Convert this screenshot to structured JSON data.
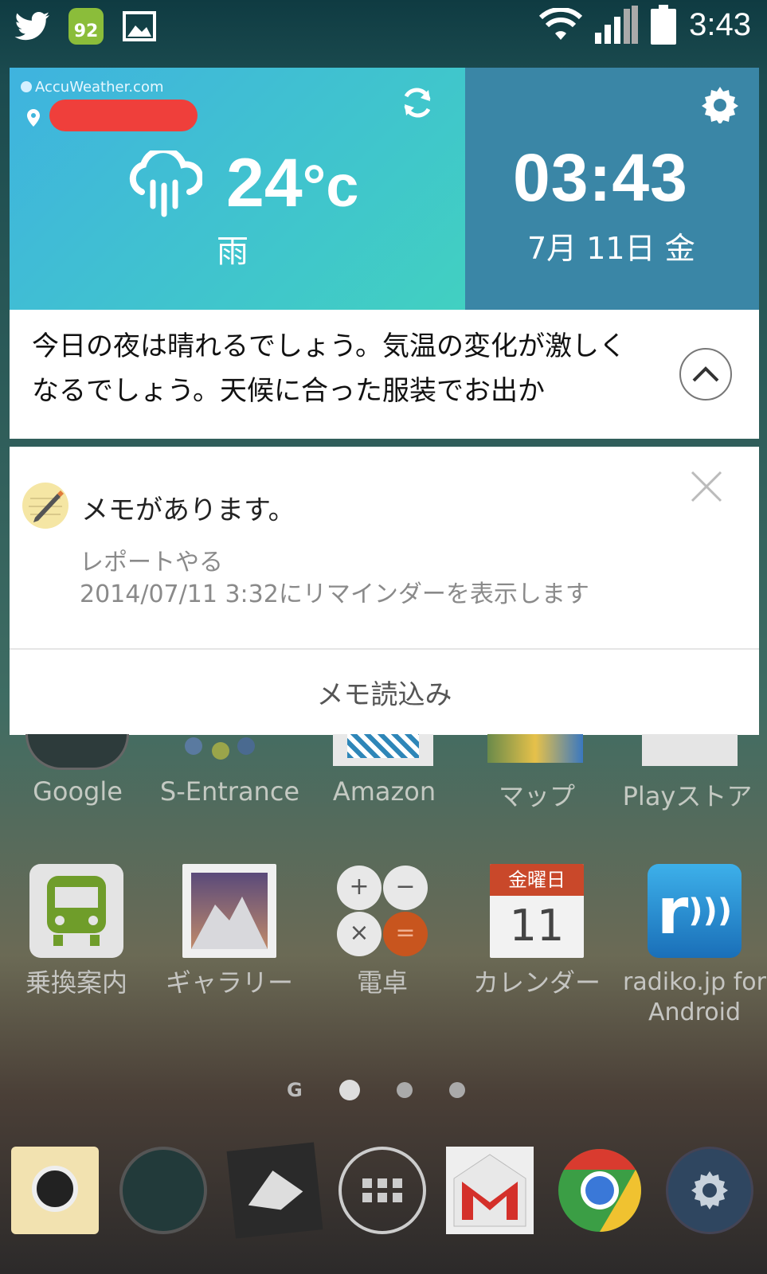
{
  "status_bar": {
    "time": "3:43",
    "notification_icons": [
      "twitter-icon",
      "android-badge-icon",
      "image-icon"
    ],
    "badge_count": "92"
  },
  "weather_widget": {
    "brand": "AccuWeather.com",
    "temperature": "24",
    "unit": "°c",
    "condition": "雨",
    "clock": "03:43",
    "date": "7月 11日 金"
  },
  "forecast": {
    "text": "今日の夜は晴れるでしょう。気温の変化が激しくなるでしょう。天候に合った服装でお出か"
  },
  "memo_notification": {
    "title": "メモがあります。",
    "subtitle": "レポートやる",
    "reminder": "2014/07/11 3:32にリマインダーを表示します",
    "action": "メモ読込み"
  },
  "apps_row1": [
    "Google",
    "S-Entrance",
    "Amazon",
    "マップ",
    "Playストア"
  ],
  "apps_row2": {
    "transit": "乗換案内",
    "gallery": "ギャラリー",
    "calculator": "電卓",
    "calendar": "カレンダー",
    "calendar_header": "金曜日",
    "calendar_day": "11",
    "radiko": "radiko.jp for Android"
  },
  "colors": {
    "weather_left": "#41c3d0",
    "weather_right": "#3a86a6",
    "redaction": "#ef3f3b"
  }
}
